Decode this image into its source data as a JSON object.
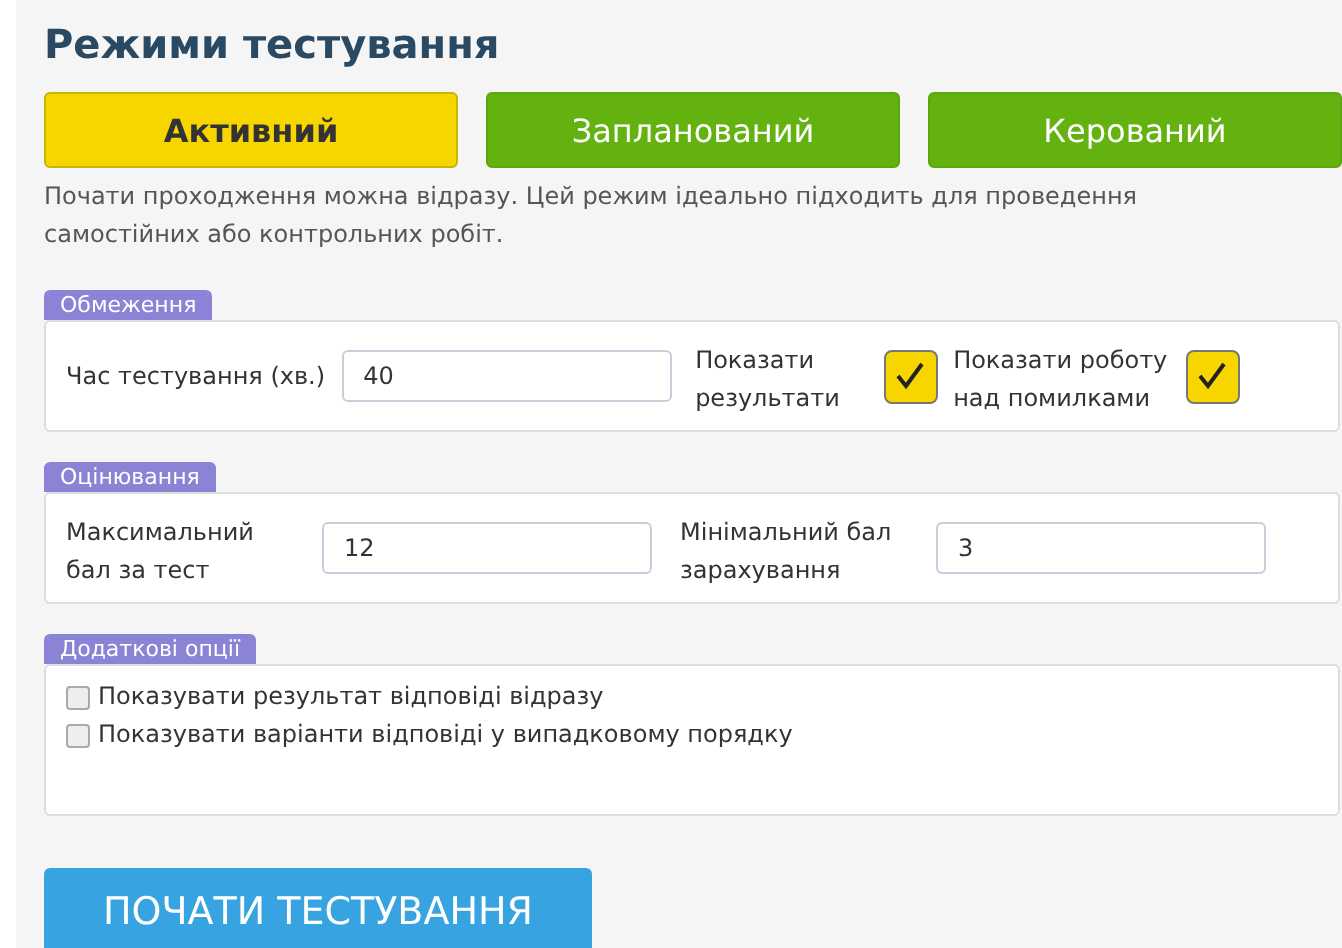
{
  "title": "Режими тестування",
  "modes": [
    {
      "label": "Активний",
      "selected": true
    },
    {
      "label": "Запланований",
      "selected": false
    },
    {
      "label": "Керований",
      "selected": false
    }
  ],
  "description": "Почати проходження можна відразу. Цей режим ідеально підходить для проведення самостійних або контрольних робіт.",
  "limits": {
    "legend": "Обмеження",
    "time_label": "Час тестування (хв.)",
    "time_value": "40",
    "toggles": [
      {
        "label": "Показати результати",
        "checked": true
      },
      {
        "label": "Показати роботу над помилками",
        "checked": true
      }
    ]
  },
  "grading": {
    "legend": "Оцінювання",
    "fields": [
      {
        "label": "Максимальний бал за тест",
        "value": "12"
      },
      {
        "label": "Мінімальний бал зарахування",
        "value": "3"
      }
    ]
  },
  "options": {
    "legend": "Додаткові опції",
    "items": [
      {
        "label": "Показувати результат відповіді відразу",
        "checked": false
      },
      {
        "label": "Показувати варіанти відповіді у випадковому порядку",
        "checked": false
      }
    ]
  },
  "start_button": "ПОЧАТИ ТЕСТУВАННЯ"
}
